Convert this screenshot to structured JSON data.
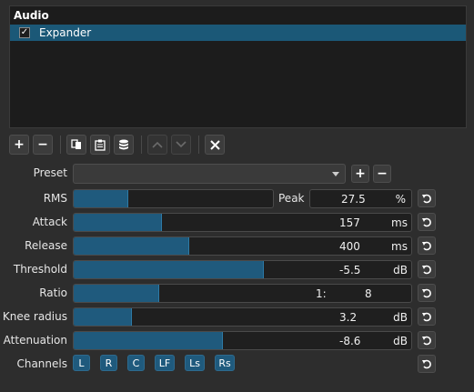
{
  "panel": {
    "header": "Audio",
    "filters": [
      {
        "name": "Expander",
        "checked": "✓"
      }
    ]
  },
  "toolbar": {
    "buttons": [
      {
        "icon": "plus-icon",
        "glyph": "+"
      },
      {
        "icon": "minus-icon",
        "glyph": "−"
      },
      {
        "icon": "copy-icon"
      },
      {
        "icon": "paste-icon"
      },
      {
        "icon": "database-icon"
      },
      {
        "icon": "chevron-up-icon",
        "glyph": "⌃"
      },
      {
        "icon": "chevron-down-icon",
        "glyph": "⌄"
      },
      {
        "icon": "close-icon",
        "glyph": "✕"
      }
    ]
  },
  "preset": {
    "label": "Preset",
    "value": "",
    "add": "+",
    "remove": "−"
  },
  "params": {
    "rms": {
      "label": "RMS",
      "fill_fraction": 0.27
    },
    "peak": {
      "label": "Peak",
      "value": "27.5",
      "unit": "%"
    },
    "attack": {
      "label": "Attack",
      "value": "157",
      "unit": "ms",
      "fill_fraction": 0.26
    },
    "release": {
      "label": "Release",
      "value": "400",
      "unit": "ms",
      "fill_fraction": 0.34
    },
    "threshold": {
      "label": "Threshold",
      "value": "-5.5",
      "unit": "dB",
      "fill_fraction": 0.56
    },
    "ratio": {
      "label": "Ratio",
      "prefix": "1:",
      "value": "8",
      "fill_fraction": 0.25
    },
    "knee": {
      "label": "Knee radius",
      "value": "3.2",
      "unit": "dB",
      "fill_fraction": 0.17
    },
    "attenuation": {
      "label": "Attenuation",
      "value": "-8.6",
      "unit": "dB",
      "fill_fraction": 0.44
    }
  },
  "channels": {
    "label": "Channels",
    "items": [
      "L",
      "R",
      "C",
      "LF",
      "Ls",
      "Rs"
    ]
  },
  "colors": {
    "accent": "#1f5a7d",
    "selection": "#1b5877",
    "background": "#2d2d2d"
  }
}
